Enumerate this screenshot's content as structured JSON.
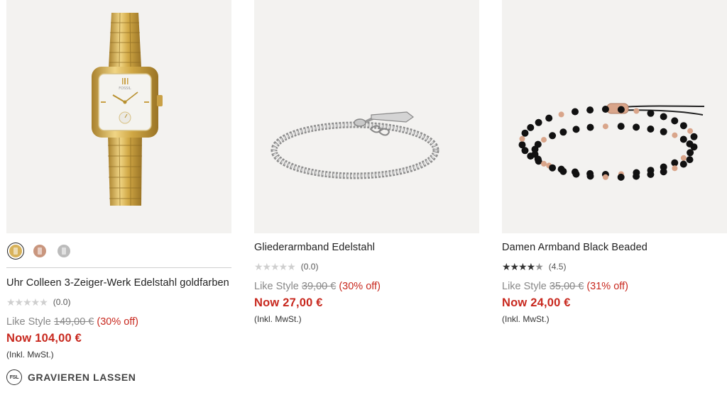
{
  "products": [
    {
      "title": "Uhr Colleen 3-Zeiger-Werk Edelstahl goldfarben",
      "swatches": [
        {
          "name": "gold",
          "color": "#d8b25a",
          "selected": true
        },
        {
          "name": "rose",
          "color": "#c9967e",
          "selected": false
        },
        {
          "name": "silver",
          "color": "#bcbcbc",
          "selected": false
        }
      ],
      "rating_stars": 0,
      "rating_text": "(0.0)",
      "compare_label": "Like Style",
      "compare_price": "149,00 €",
      "discount": "(30% off)",
      "now_label": "Now",
      "now_price": "104,00 €",
      "tax_note": "(Inkl. MwSt.)",
      "engrave_badge": "FSL",
      "engrave_label": "GRAVIEREN LASSEN"
    },
    {
      "title": "Gliederarmband Edelstahl",
      "rating_stars": 0,
      "rating_text": "(0.0)",
      "compare_label": "Like Style",
      "compare_price": "39,00 €",
      "discount": "(30% off)",
      "now_label": "Now",
      "now_price": "27,00 €",
      "tax_note": "(Inkl. MwSt.)"
    },
    {
      "title": "Damen Armband Black Beaded",
      "rating_stars": 4.5,
      "rating_text": "(4.5)",
      "compare_label": "Like Style",
      "compare_price": "35,00 €",
      "discount": "(31% off)",
      "now_label": "Now",
      "now_price": "24,00 €",
      "tax_note": "(Inkl. MwSt.)"
    }
  ],
  "colors": {
    "sale_red": "#c8281e",
    "image_bg": "#f3f2f0"
  }
}
